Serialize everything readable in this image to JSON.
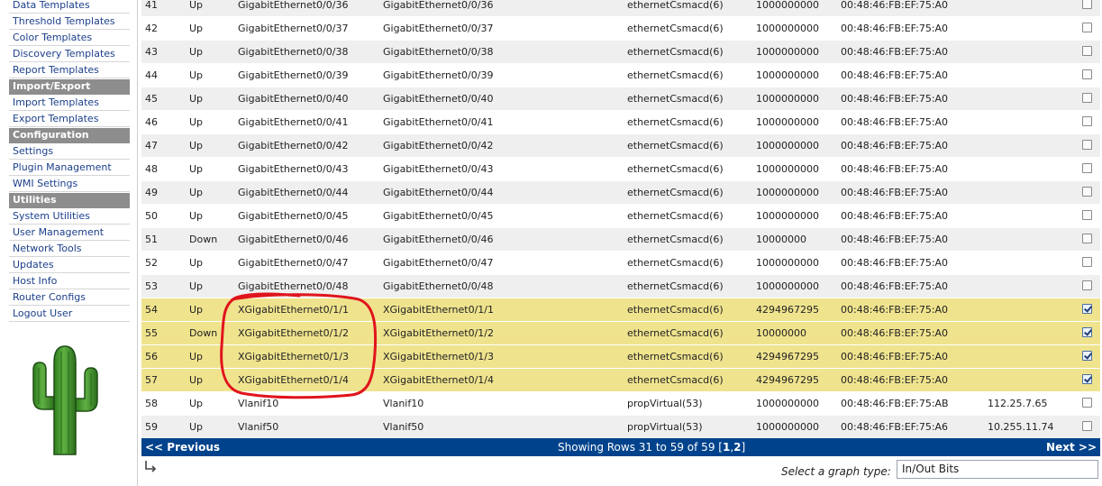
{
  "sidebar": {
    "items": [
      {
        "label": "Data Templates",
        "kind": "link"
      },
      {
        "label": "Threshold Templates",
        "kind": "link"
      },
      {
        "label": "Color Templates",
        "kind": "link"
      },
      {
        "label": "Discovery Templates",
        "kind": "link"
      },
      {
        "label": "Report Templates",
        "kind": "link"
      },
      {
        "label": "Import/Export",
        "kind": "header"
      },
      {
        "label": "Import Templates",
        "kind": "link"
      },
      {
        "label": "Export Templates",
        "kind": "link"
      },
      {
        "label": "Configuration",
        "kind": "header"
      },
      {
        "label": "Settings",
        "kind": "link"
      },
      {
        "label": "Plugin Management",
        "kind": "link"
      },
      {
        "label": "WMI Settings",
        "kind": "link"
      },
      {
        "label": "Utilities",
        "kind": "header"
      },
      {
        "label": "System Utilities",
        "kind": "link"
      },
      {
        "label": "User Management",
        "kind": "link"
      },
      {
        "label": "Network Tools",
        "kind": "link"
      },
      {
        "label": "Updates",
        "kind": "link"
      },
      {
        "label": "Host Info",
        "kind": "link"
      },
      {
        "label": "Router Configs",
        "kind": "link"
      },
      {
        "label": "Logout User",
        "kind": "link"
      }
    ],
    "logo_icon": "cactus-logo-icon"
  },
  "table": {
    "rows": [
      {
        "idx": "41",
        "status": "Up",
        "name": "GigabitEthernet0/0/36",
        "desc": "GigabitEthernet0/0/36",
        "type": "ethernetCsmacd(6)",
        "speed": "1000000000",
        "mac": "00:48:46:FB:EF:75:A0",
        "ip": "",
        "checked": false
      },
      {
        "idx": "42",
        "status": "Up",
        "name": "GigabitEthernet0/0/37",
        "desc": "GigabitEthernet0/0/37",
        "type": "ethernetCsmacd(6)",
        "speed": "1000000000",
        "mac": "00:48:46:FB:EF:75:A0",
        "ip": "",
        "checked": false
      },
      {
        "idx": "43",
        "status": "Up",
        "name": "GigabitEthernet0/0/38",
        "desc": "GigabitEthernet0/0/38",
        "type": "ethernetCsmacd(6)",
        "speed": "1000000000",
        "mac": "00:48:46:FB:EF:75:A0",
        "ip": "",
        "checked": false
      },
      {
        "idx": "44",
        "status": "Up",
        "name": "GigabitEthernet0/0/39",
        "desc": "GigabitEthernet0/0/39",
        "type": "ethernetCsmacd(6)",
        "speed": "1000000000",
        "mac": "00:48:46:FB:EF:75:A0",
        "ip": "",
        "checked": false
      },
      {
        "idx": "45",
        "status": "Up",
        "name": "GigabitEthernet0/0/40",
        "desc": "GigabitEthernet0/0/40",
        "type": "ethernetCsmacd(6)",
        "speed": "1000000000",
        "mac": "00:48:46:FB:EF:75:A0",
        "ip": "",
        "checked": false
      },
      {
        "idx": "46",
        "status": "Up",
        "name": "GigabitEthernet0/0/41",
        "desc": "GigabitEthernet0/0/41",
        "type": "ethernetCsmacd(6)",
        "speed": "1000000000",
        "mac": "00:48:46:FB:EF:75:A0",
        "ip": "",
        "checked": false
      },
      {
        "idx": "47",
        "status": "Up",
        "name": "GigabitEthernet0/0/42",
        "desc": "GigabitEthernet0/0/42",
        "type": "ethernetCsmacd(6)",
        "speed": "1000000000",
        "mac": "00:48:46:FB:EF:75:A0",
        "ip": "",
        "checked": false
      },
      {
        "idx": "48",
        "status": "Up",
        "name": "GigabitEthernet0/0/43",
        "desc": "GigabitEthernet0/0/43",
        "type": "ethernetCsmacd(6)",
        "speed": "1000000000",
        "mac": "00:48:46:FB:EF:75:A0",
        "ip": "",
        "checked": false
      },
      {
        "idx": "49",
        "status": "Up",
        "name": "GigabitEthernet0/0/44",
        "desc": "GigabitEthernet0/0/44",
        "type": "ethernetCsmacd(6)",
        "speed": "1000000000",
        "mac": "00:48:46:FB:EF:75:A0",
        "ip": "",
        "checked": false
      },
      {
        "idx": "50",
        "status": "Up",
        "name": "GigabitEthernet0/0/45",
        "desc": "GigabitEthernet0/0/45",
        "type": "ethernetCsmacd(6)",
        "speed": "1000000000",
        "mac": "00:48:46:FB:EF:75:A0",
        "ip": "",
        "checked": false
      },
      {
        "idx": "51",
        "status": "Down",
        "name": "GigabitEthernet0/0/46",
        "desc": "GigabitEthernet0/0/46",
        "type": "ethernetCsmacd(6)",
        "speed": "10000000",
        "mac": "00:48:46:FB:EF:75:A0",
        "ip": "",
        "checked": false
      },
      {
        "idx": "52",
        "status": "Up",
        "name": "GigabitEthernet0/0/47",
        "desc": "GigabitEthernet0/0/47",
        "type": "ethernetCsmacd(6)",
        "speed": "1000000000",
        "mac": "00:48:46:FB:EF:75:A0",
        "ip": "",
        "checked": false
      },
      {
        "idx": "53",
        "status": "Up",
        "name": "GigabitEthernet0/0/48",
        "desc": "GigabitEthernet0/0/48",
        "type": "ethernetCsmacd(6)",
        "speed": "1000000000",
        "mac": "00:48:46:FB:EF:75:A0",
        "ip": "",
        "checked": false
      },
      {
        "idx": "54",
        "status": "Up",
        "name": "XGigabitEthernet0/1/1",
        "desc": "XGigabitEthernet0/1/1",
        "type": "ethernetCsmacd(6)",
        "speed": "4294967295",
        "mac": "00:48:46:FB:EF:75:A0",
        "ip": "",
        "checked": true
      },
      {
        "idx": "55",
        "status": "Down",
        "name": "XGigabitEthernet0/1/2",
        "desc": "XGigabitEthernet0/1/2",
        "type": "ethernetCsmacd(6)",
        "speed": "10000000",
        "mac": "00:48:46:FB:EF:75:A0",
        "ip": "",
        "checked": true
      },
      {
        "idx": "56",
        "status": "Up",
        "name": "XGigabitEthernet0/1/3",
        "desc": "XGigabitEthernet0/1/3",
        "type": "ethernetCsmacd(6)",
        "speed": "4294967295",
        "mac": "00:48:46:FB:EF:75:A0",
        "ip": "",
        "checked": true
      },
      {
        "idx": "57",
        "status": "Up",
        "name": "XGigabitEthernet0/1/4",
        "desc": "XGigabitEthernet0/1/4",
        "type": "ethernetCsmacd(6)",
        "speed": "4294967295",
        "mac": "00:48:46:FB:EF:75:A0",
        "ip": "",
        "checked": true
      },
      {
        "idx": "58",
        "status": "Up",
        "name": "Vlanif10",
        "desc": "Vlanif10",
        "type": "propVirtual(53)",
        "speed": "1000000000",
        "mac": "00:48:46:FB:EF:75:AB",
        "ip": "112.25.7.65",
        "checked": false
      },
      {
        "idx": "59",
        "status": "Up",
        "name": "Vlanif50",
        "desc": "Vlanif50",
        "type": "propVirtual(53)",
        "speed": "1000000000",
        "mac": "00:48:46:FB:EF:75:A6",
        "ip": "10.255.11.74",
        "checked": false
      }
    ]
  },
  "nav": {
    "previous_label": "<< Previous",
    "showing_label": "Showing Rows 31 to 59 of 59 [",
    "page_1": "1",
    "page_sep": ",",
    "page_2": "2",
    "showing_end": "]",
    "next_label": "Next >>"
  },
  "footer": {
    "graph_type_label": "Select a graph type:",
    "graph_type_value": "In/Out Bits"
  },
  "colors": {
    "nav_bar": "#00438c",
    "selected_row": "#efe38e",
    "sidebar_header": "#8d8d8d",
    "highlight_stroke": "#e0141c"
  }
}
